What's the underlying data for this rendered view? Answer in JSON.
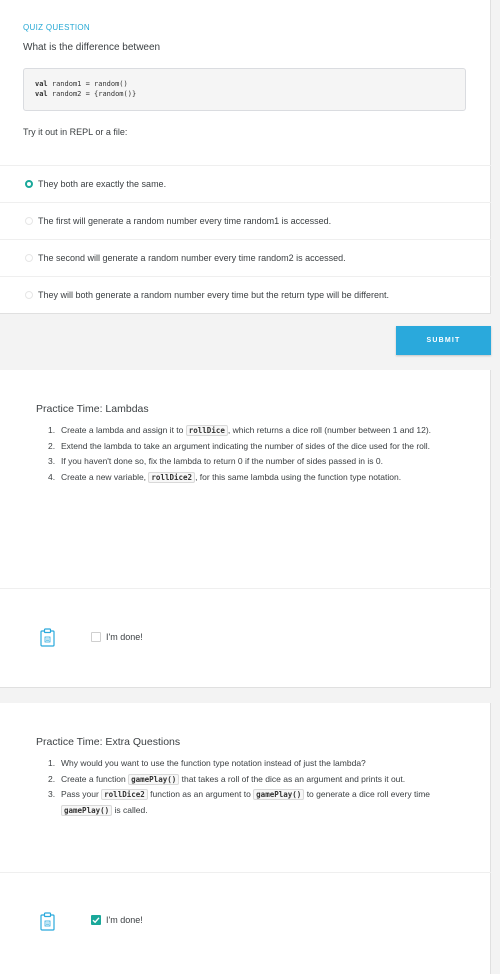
{
  "quiz": {
    "header": "QUIZ QUESTION",
    "question": "What is the difference between",
    "code_lines": [
      {
        "kw": "val",
        "rest": " random1 = random()"
      },
      {
        "kw": "val",
        "rest": " random2 = {random()}"
      }
    ],
    "try_it": "Try it out in REPL or a file:",
    "options": [
      {
        "label": "They both are exactly the same.",
        "selected": true
      },
      {
        "label": "The first will generate a random number every time random1 is accessed.",
        "selected": false
      },
      {
        "label": "The second will generate a random number every time random2 is accessed.",
        "selected": false
      },
      {
        "label": "They will both generate a random number every time but the return type will be different.",
        "selected": false
      }
    ],
    "submit_label": "SUBMIT"
  },
  "practice1": {
    "title": "Practice Time: Lambdas",
    "items": [
      {
        "num": "1.",
        "parts": [
          "Create a lambda and assign it to ",
          "rollDice",
          ", which returns a dice roll (number between 1 and 12)."
        ]
      },
      {
        "num": "2.",
        "text": "Extend the lambda to take an argument indicating the number of sides of the dice used for the roll."
      },
      {
        "num": "3.",
        "text": "If you haven't done so, fix the lambda to return 0 if the number of sides passed in is 0."
      },
      {
        "num": "4.",
        "parts": [
          "Create a new variable, ",
          "rollDice2",
          ", for this same lambda using the function type notation."
        ]
      }
    ],
    "done_label": "I'm done!",
    "done_checked": false
  },
  "practice2": {
    "title": "Practice Time: Extra Questions",
    "items": [
      {
        "num": "1.",
        "text": "Why would you want to use the function type notation instead of just the lambda?"
      },
      {
        "num": "2.",
        "parts": [
          "Create a function ",
          "gamePlay()",
          " that takes a roll of the dice as an argument and prints it out."
        ]
      },
      {
        "num": "3.",
        "parts": [
          "Pass your ",
          "rollDice2",
          " function as an argument to ",
          "gamePlay()",
          " to generate a dice roll every time ",
          "gamePlay()",
          " is called."
        ]
      }
    ],
    "done_label": "I'm done!",
    "done_checked": true
  },
  "colors": {
    "accent": "#2aa9dc",
    "teal": "#1aa89a"
  },
  "icons": {
    "clipboard": "clipboard-icon"
  }
}
